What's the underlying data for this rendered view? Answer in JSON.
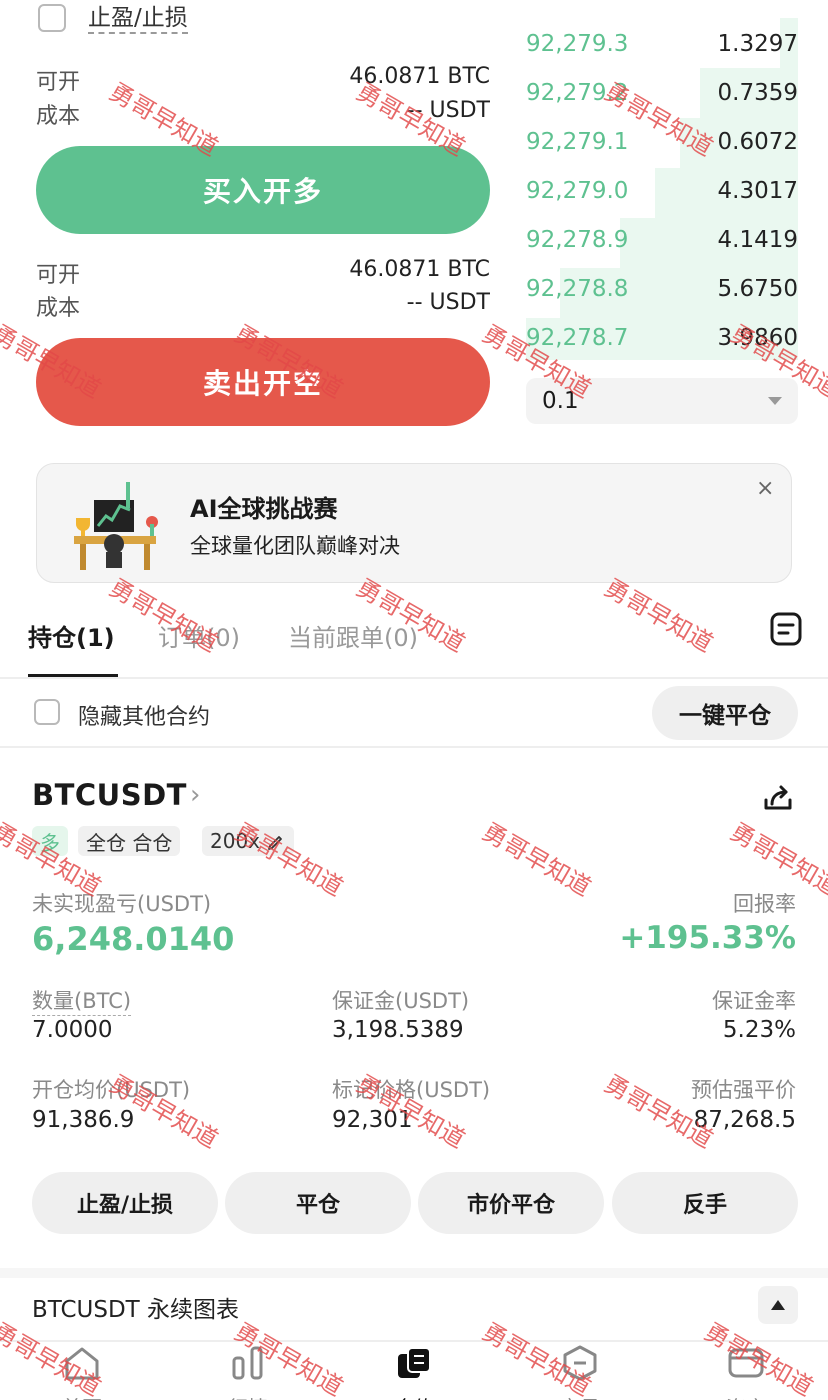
{
  "order_form": {
    "tpsl_label": "止盈/止损",
    "buy": {
      "available_label": "可开",
      "available_value": "46.0871 BTC",
      "cost_label": "成本",
      "cost_value": "-- USDT",
      "button_label": "买入开多"
    },
    "sell": {
      "available_label": "可开",
      "available_value": "46.0871 BTC",
      "cost_label": "成本",
      "cost_value": "-- USDT",
      "button_label": "卖出开空"
    }
  },
  "order_book": {
    "rows": [
      {
        "price": "92,279.3",
        "qty": "1.3297"
      },
      {
        "price": "92,279.2",
        "qty": "0.7359"
      },
      {
        "price": "92,279.1",
        "qty": "0.6072"
      },
      {
        "price": "92,279.0",
        "qty": "4.3017"
      },
      {
        "price": "92,278.9",
        "qty": "4.1419"
      },
      {
        "price": "92,278.8",
        "qty": "5.6750"
      },
      {
        "price": "92,278.7",
        "qty": "3.9860"
      }
    ],
    "depth_step": "0.1"
  },
  "banner": {
    "title": "AI全球挑战赛",
    "subtitle": "全球量化团队巅峰对决",
    "close": "×"
  },
  "tabs": [
    {
      "label": "持仓(1)"
    },
    {
      "label": "订单(0)"
    },
    {
      "label": "当前跟单(0)"
    }
  ],
  "filters": {
    "hide_other_label": "隐藏其他合约",
    "close_all_label": "一键平仓"
  },
  "position": {
    "symbol": "BTCUSDT",
    "side": "多",
    "margin_mode": "全仓 合仓",
    "leverage": "200x",
    "pnl_label": "未实现盈亏(USDT)",
    "pnl_value": "6,248.0140",
    "roe_label": "回报率",
    "roe_value": "+195.33%",
    "size_label": "数量(BTC)",
    "size_value": "7.0000",
    "margin_label": "保证金(USDT)",
    "margin_value": "3,198.5389",
    "margin_ratio_label": "保证金率",
    "margin_ratio_value": "5.23%",
    "entry_label": "开仓均价(USDT)",
    "entry_value": "91,386.9",
    "mark_label": "标记价格(USDT)",
    "mark_value": "92,301",
    "liq_label": "预估强平价",
    "liq_value": "87,268.5",
    "actions": [
      "止盈/止损",
      "平仓",
      "市价平仓",
      "反手"
    ]
  },
  "chart_section": {
    "title": "BTCUSDT 永续图表"
  },
  "bottom_nav": [
    {
      "label": "首页",
      "icon": "home-icon"
    },
    {
      "label": "行情",
      "icon": "market-bars-icon"
    },
    {
      "label": "合约",
      "icon": "futures-icon"
    },
    {
      "label": "交易",
      "icon": "trade-hex-icon"
    },
    {
      "label": "资产",
      "icon": "wallet-icon"
    }
  ],
  "watermark": "勇哥早知道",
  "colors": {
    "buy": "#5ec190",
    "sell": "#e5584b",
    "text": "#1a1a1a",
    "muted": "#8a8a8a"
  }
}
